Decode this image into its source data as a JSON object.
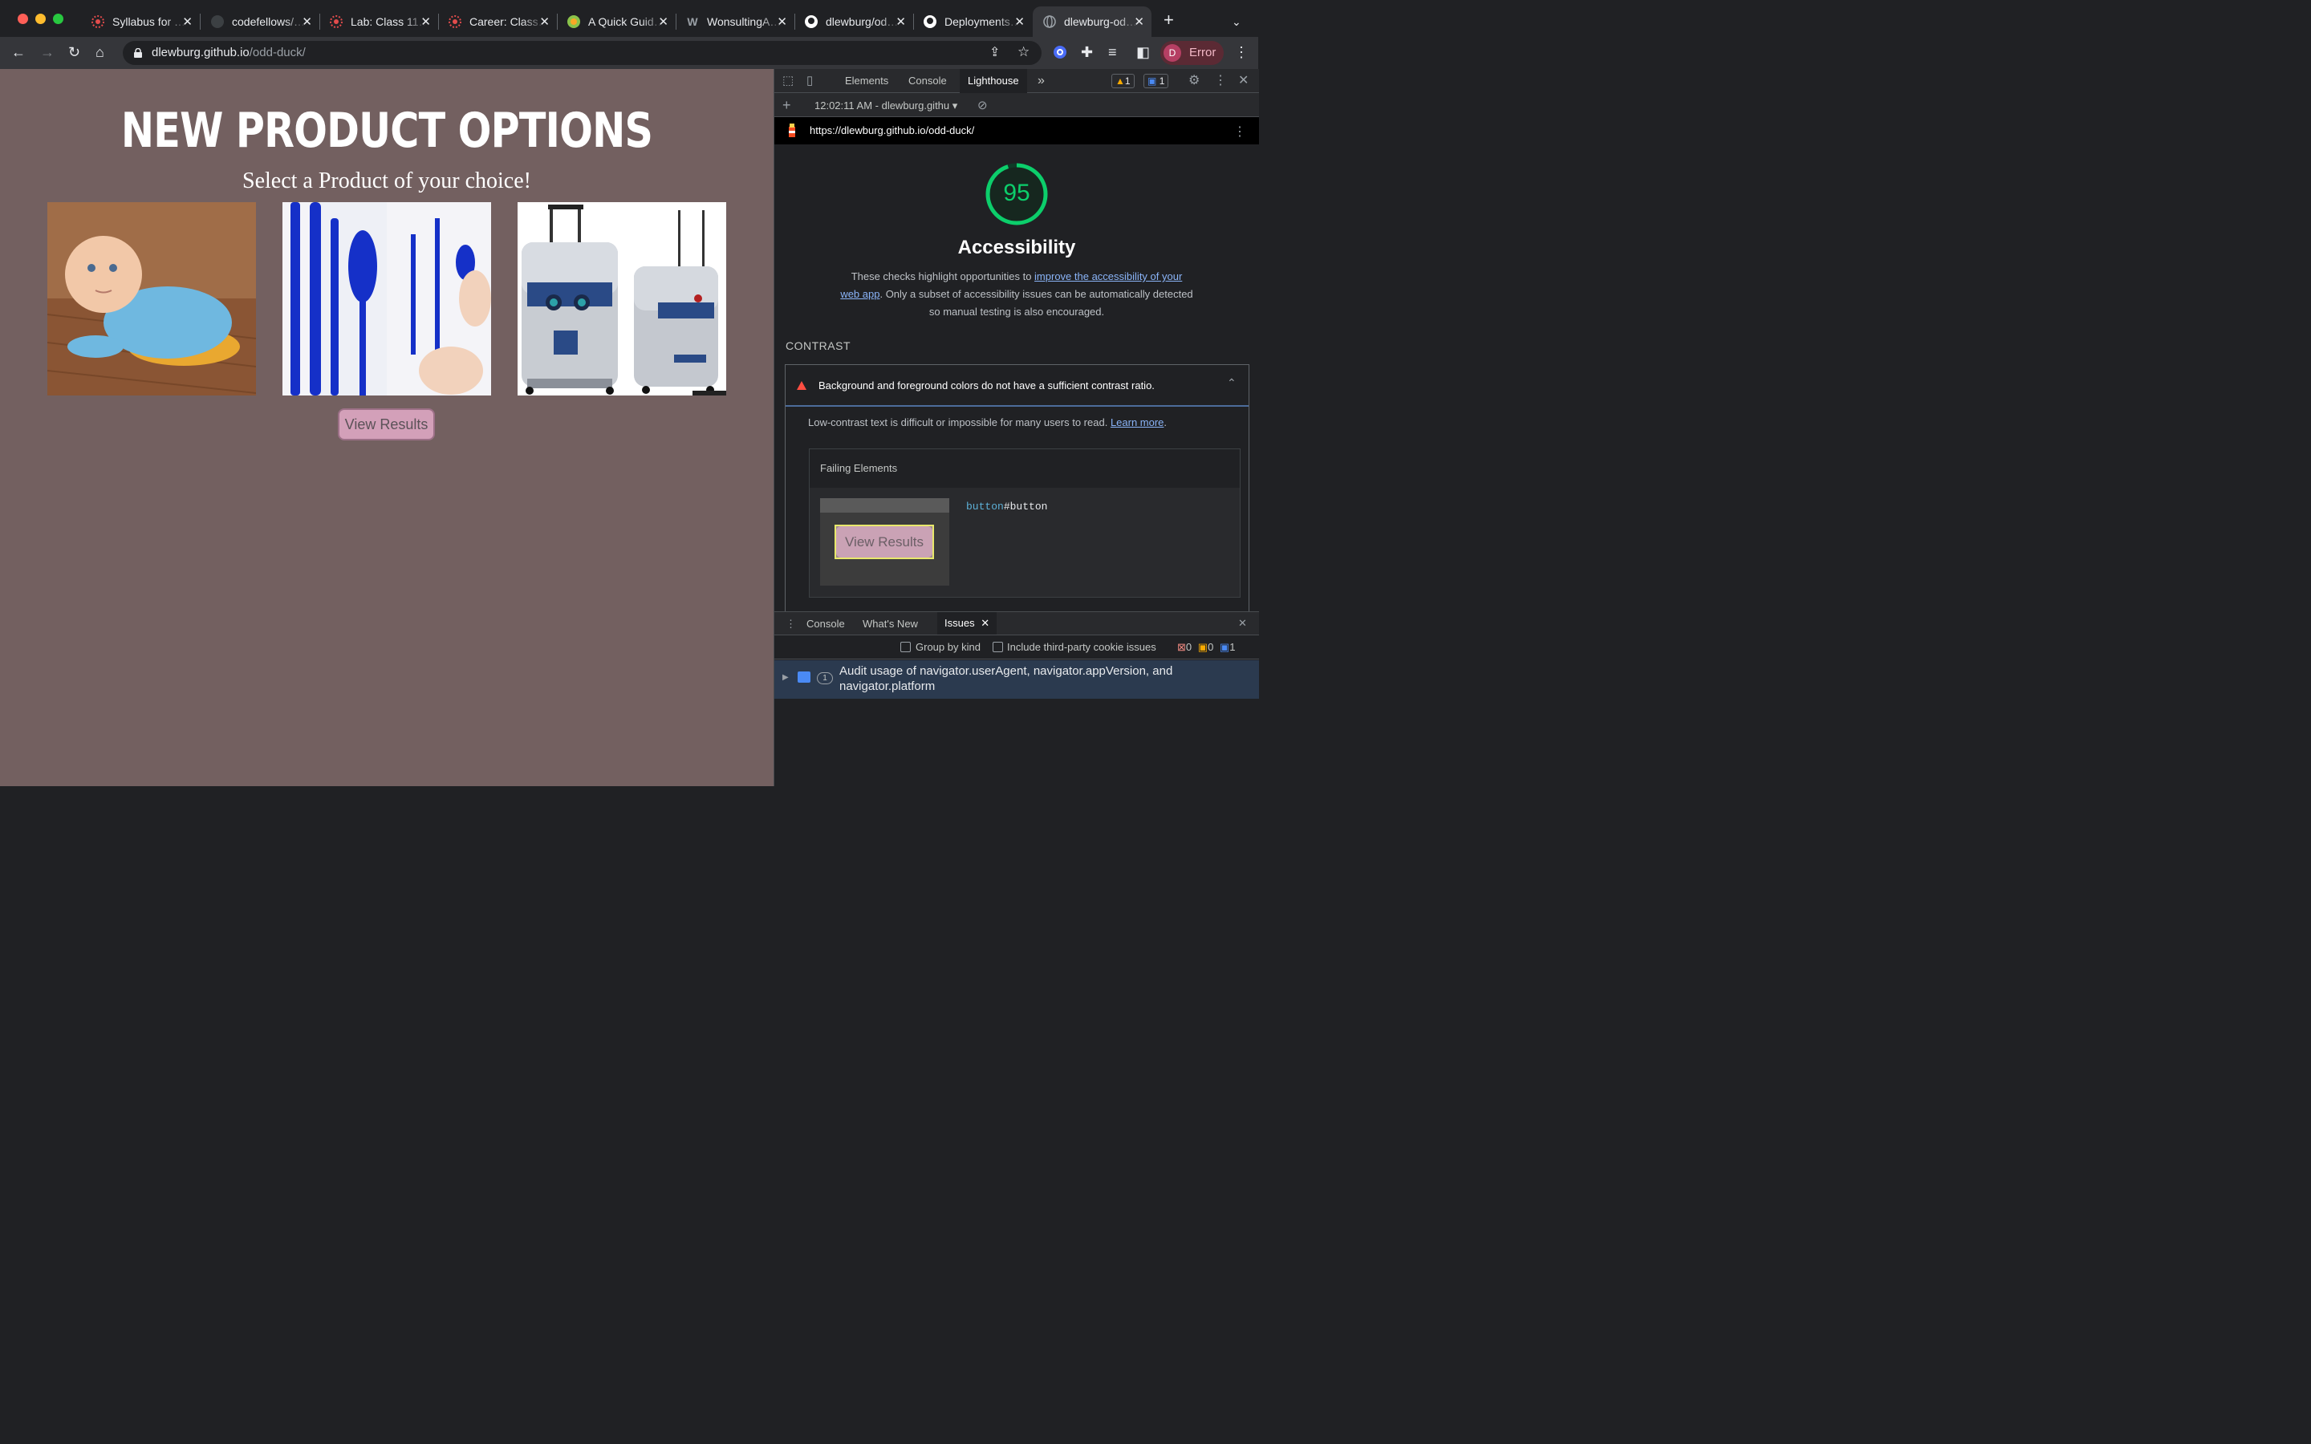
{
  "browser": {
    "tabs": [
      {
        "title": "Syllabus for …",
        "icon": "codefellows-icon",
        "color": "#e34c4c"
      },
      {
        "title": "codefellows/…",
        "icon": "github-icon",
        "color": "#9aa0a6"
      },
      {
        "title": "Lab: Class 11…",
        "icon": "codefellows-icon",
        "color": "#e34c4c"
      },
      {
        "title": "Career: Class…",
        "icon": "codefellows-icon",
        "color": "#e34c4c"
      },
      {
        "title": "A Quick Guid…",
        "icon": "guide-icon",
        "color": "#8bc34a"
      },
      {
        "title": "WonsultingA…",
        "icon": "wonsulting-icon",
        "color": "#9aa0a6"
      },
      {
        "title": "dlewburg/od…",
        "icon": "github-icon",
        "color": "#ffffff"
      },
      {
        "title": "Deployments…",
        "icon": "github-icon",
        "color": "#ffffff"
      },
      {
        "title": "dlewburg-od…",
        "icon": "globe-icon",
        "color": "#9aa0a6",
        "active": true
      }
    ],
    "url_host": "dlewburg.github.io",
    "url_path": "/odd-duck/",
    "profile_initial": "D",
    "profile_label": "Error"
  },
  "page": {
    "heading": "NEW PRODUCT OPTIONS",
    "subheading": "Select a Product of your choice!",
    "products": [
      "baby mop onesie",
      "blue pen cutlery",
      "R2-D2 suitcase"
    ],
    "button_label": "View Results",
    "bg_color": "#736060"
  },
  "devtools": {
    "tabs": [
      "Elements",
      "Console",
      "Lighthouse"
    ],
    "active_tab": "Lighthouse",
    "warning_count": "1",
    "message_count": "1",
    "report_selector": "12:02:11 AM - dlewburg.githu",
    "report_url": "https://dlewburg.github.io/odd-duck/",
    "score": "95",
    "category": "Accessibility",
    "desc_before": "These checks highlight opportunities to ",
    "desc_link": "improve the accessibility of your web app",
    "desc_after": ". Only a subset of accessibility issues can be automatically detected so manual testing is also encouraged.",
    "section": "CONTRAST",
    "audit_title": "Background and foreground colors do not have a sufficient contrast ratio.",
    "audit_body": "Low-contrast text is difficult or impossible for many users to read.",
    "learn_more": "Learn more",
    "failing_header": "Failing Elements",
    "thumb_label": "View Results",
    "selector_tag": "button",
    "selector_id": "#button",
    "drawer_tabs": [
      "Console",
      "What's New",
      "Issues"
    ],
    "group_by_kind": "Group by kind",
    "third_party": "Include third-party cookie issues",
    "issue_counts": {
      "errors": "0",
      "warnings": "0",
      "info": "1"
    },
    "issue_badge": "1",
    "issue_title": "Audit usage of navigator.userAgent, navigator.appVersion, and navigator.platform",
    "score_color": "#0cce6b"
  }
}
